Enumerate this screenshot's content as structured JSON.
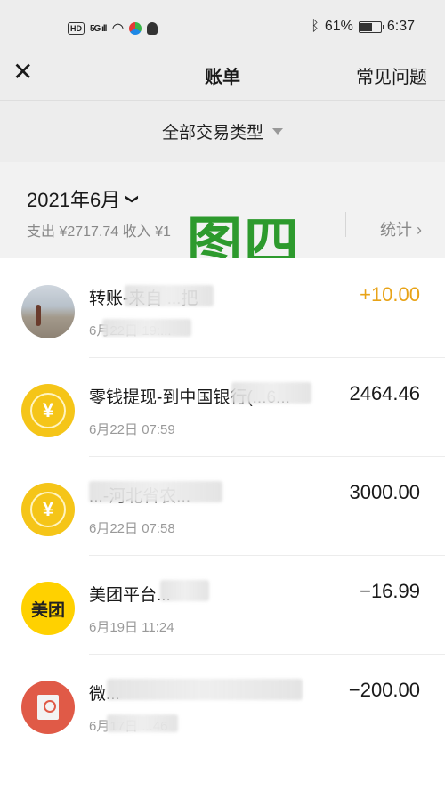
{
  "status_bar": {
    "hd": "HD",
    "signal": "5G ıll",
    "battery_text": "61%",
    "battery_level": 0.61,
    "time": "6:37"
  },
  "nav": {
    "close_icon": "close-icon",
    "title": "账单",
    "faq": "常见问题"
  },
  "filter": {
    "label": "全部交易类型"
  },
  "summary": {
    "month": "2021年6月",
    "totals": "支出 ¥2717.74 收入 ¥1",
    "stats": "统计 ›",
    "watermark": "图四"
  },
  "transactions": [
    {
      "icon": "avatar-photo",
      "title": "转账-来自 ...把",
      "time": "6月22日 19:...",
      "amount": "+10.00",
      "type": "income"
    },
    {
      "icon": "yuan-coin-icon",
      "glyph": "¥",
      "title": "零钱提现-到中国银行(...6...",
      "time": "6月22日 07:59",
      "amount": "2464.46",
      "type": "neutral"
    },
    {
      "icon": "yuan-coin-icon",
      "glyph": "¥",
      "title": "...-河北省农...",
      "time": "6月22日 07:58",
      "amount": "3000.00",
      "type": "neutral"
    },
    {
      "icon": "meituan-logo",
      "glyph": "美团",
      "title": "美团平台...",
      "time": "6月19日 11:24",
      "amount": "−16.99",
      "type": "expense"
    },
    {
      "icon": "red-envelope-icon",
      "title": "微...",
      "time": "6月17日 ...46",
      "amount": "−200.00",
      "type": "expense"
    }
  ]
}
